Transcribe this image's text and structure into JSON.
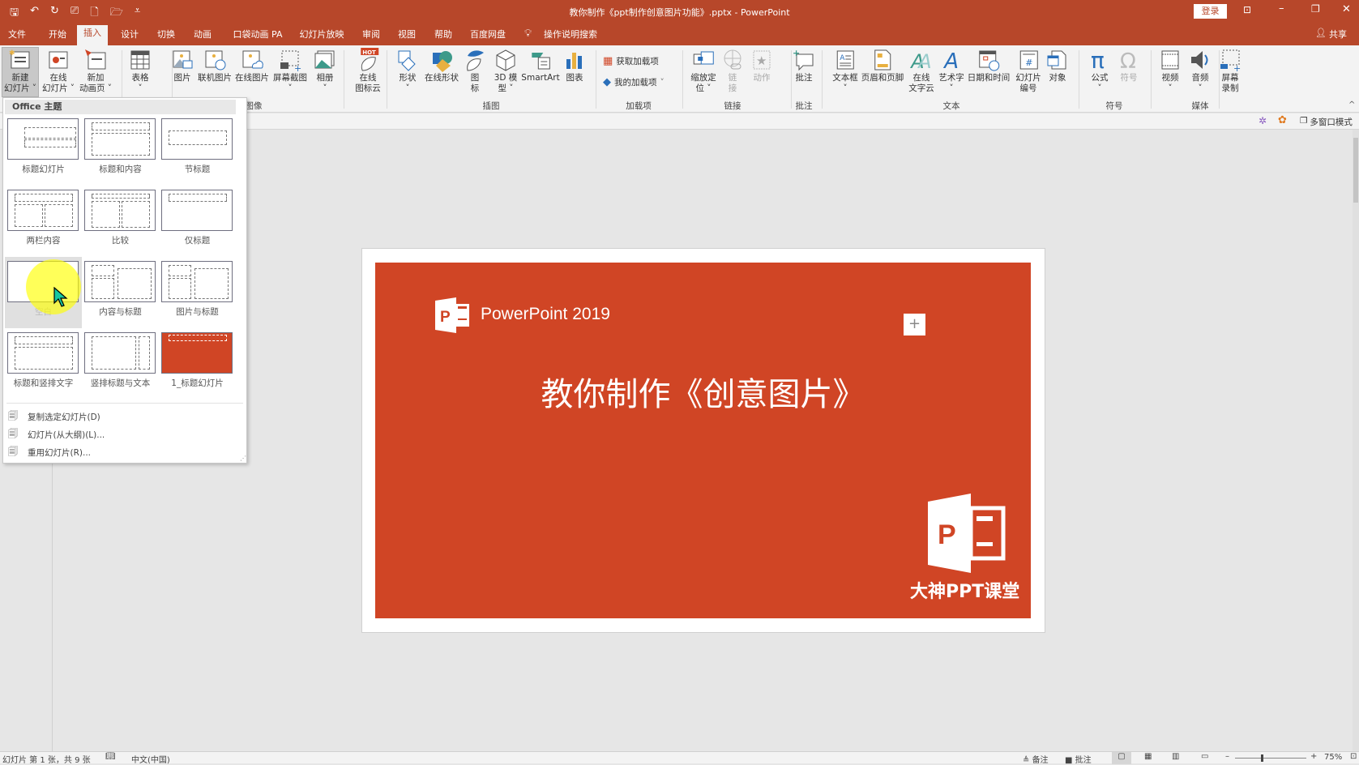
{
  "titlebar": {
    "title": "教你制作《ppt制作创意图片功能》.pptx  -  PowerPoint",
    "login": "登录",
    "qat_icons": [
      "save-icon",
      "undo-icon",
      "redo-icon",
      "present-from-start-icon",
      "new-file-icon",
      "open-folder-icon",
      "customize-qat-icon"
    ]
  },
  "tabs": [
    "文件",
    "开始",
    "插入",
    "设计",
    "切换",
    "动画",
    "口袋动画 PA",
    "幻灯片放映",
    "审阅",
    "视图",
    "帮助",
    "百度网盘"
  ],
  "active_tab": "插入",
  "tell_me": "操作说明搜索",
  "share": "共享",
  "ribbon": {
    "buttons": [
      {
        "l1": "新建",
        "l2": "幻灯片 ˅",
        "icon": "new-slide-icon",
        "selected": true
      },
      {
        "l1": "在线",
        "l2": "幻灯片 ˅",
        "icon": "online-slide-icon"
      },
      {
        "l1": "新加",
        "l2": "动画页 ˅",
        "icon": "new-animation-page-icon"
      },
      {
        "l1": "表格",
        "l2": "˅",
        "icon": "table-icon"
      },
      {
        "l1": "图片",
        "l2": "",
        "icon": "picture-icon"
      },
      {
        "l1": "联机图片",
        "l2": "",
        "icon": "online-picture-icon"
      },
      {
        "l1": "在线图片",
        "l2": "",
        "icon": "cloud-picture-icon"
      },
      {
        "l1": "屏幕截图",
        "l2": "˅",
        "icon": "screenshot-icon"
      },
      {
        "l1": "相册",
        "l2": "˅",
        "icon": "photo-album-icon"
      },
      {
        "l1": "在线",
        "l2": "图标云",
        "icon": "icon-cloud-icon"
      },
      {
        "l1": "形状",
        "l2": "˅",
        "icon": "shapes-icon"
      },
      {
        "l1": "在线形状",
        "l2": "",
        "icon": "online-shapes-icon"
      },
      {
        "l1": "图",
        "l2": "标",
        "icon": "icons-icon"
      },
      {
        "l1": "3D 模",
        "l2": "型 ˅",
        "icon": "3d-model-icon"
      },
      {
        "l1": "SmartArt",
        "l2": "",
        "icon": "smartart-icon"
      },
      {
        "l1": "图表",
        "l2": "",
        "icon": "chart-icon"
      },
      {
        "l1": "缩放定",
        "l2": "位 ˅",
        "icon": "zoom-icon"
      },
      {
        "l1": "链",
        "l2": "接",
        "icon": "link-icon",
        "dim": true
      },
      {
        "l1": "动作",
        "l2": "",
        "icon": "action-icon",
        "dim": true
      },
      {
        "l1": "批注",
        "l2": "",
        "icon": "comment-icon"
      },
      {
        "l1": "文本框",
        "l2": "˅",
        "icon": "textbox-icon"
      },
      {
        "l1": "页眉和页脚",
        "l2": "",
        "icon": "header-footer-icon"
      },
      {
        "l1": "在线",
        "l2": "文字云",
        "icon": "word-cloud-icon"
      },
      {
        "l1": "艺术字",
        "l2": "˅",
        "icon": "wordart-icon"
      },
      {
        "l1": "日期和时间",
        "l2": "",
        "icon": "date-time-icon"
      },
      {
        "l1": "幻灯片",
        "l2": "编号",
        "icon": "slide-number-icon"
      },
      {
        "l1": "对象",
        "l2": "",
        "icon": "object-icon"
      },
      {
        "l1": "公式",
        "l2": "˅",
        "icon": "equation-icon"
      },
      {
        "l1": "符号",
        "l2": "",
        "icon": "symbol-icon",
        "dim": true
      },
      {
        "l1": "视频",
        "l2": "˅",
        "icon": "video-icon"
      },
      {
        "l1": "音频",
        "l2": "˅",
        "icon": "audio-icon"
      },
      {
        "l1": "屏幕",
        "l2": "录制",
        "icon": "screen-recording-icon"
      }
    ],
    "addins": {
      "get": "获取加载项",
      "mine": "我的加载项"
    },
    "groups": [
      "图像",
      "插图",
      "加载项",
      "链接",
      "批注",
      "文本",
      "符号",
      "媒体"
    ]
  },
  "subbar": {
    "multiwindow": "多窗口模式"
  },
  "dropdown": {
    "header": "Office 主题",
    "layouts": [
      "标题幻灯片",
      "标题和内容",
      "节标题",
      "两栏内容",
      "比较",
      "仅标题",
      "空白",
      "内容与标题",
      "图片与标题",
      "标题和竖排文字",
      "竖排标题与文本",
      "1_标题幻灯片"
    ],
    "hovered": "空白",
    "menu": [
      "复制选定幻灯片(D)",
      "幻灯片(从大纲)(L)...",
      "重用幻灯片(R)..."
    ]
  },
  "slide": {
    "brand": "PowerPoint 2019",
    "title": "教你制作《创意图片》",
    "logo_text": "大神PPT课堂",
    "bg_color": "#d04525"
  },
  "status": {
    "slide_info": "幻灯片 第 1 张，共 9 张",
    "language": "中文(中国)",
    "notes": "备注",
    "comments": "批注",
    "zoom": "75%"
  },
  "colors": {
    "accent": "#b7472a",
    "slide": "#d04525"
  }
}
